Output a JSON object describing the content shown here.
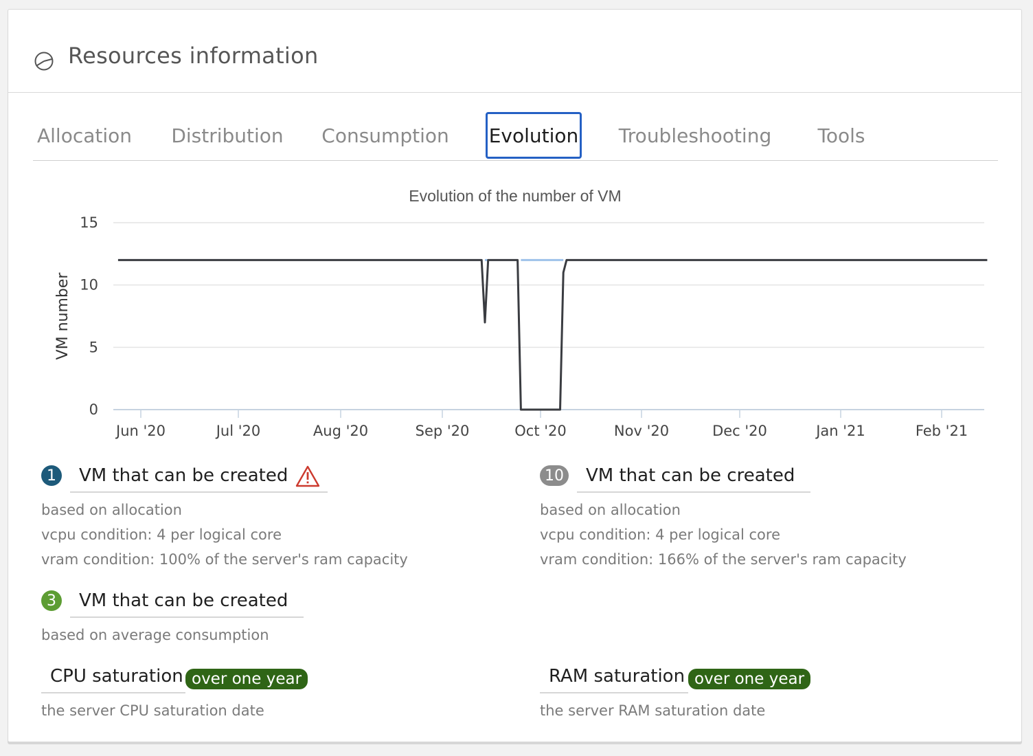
{
  "header": {
    "title": "Resources information",
    "icon": "pie-chart-icon"
  },
  "tabs": [
    {
      "label": "Allocation",
      "active": false
    },
    {
      "label": "Distribution",
      "active": false
    },
    {
      "label": "Consumption",
      "active": false
    },
    {
      "label": "Evolution",
      "active": true
    },
    {
      "label": "Troubleshooting",
      "active": false
    },
    {
      "label": "Tools",
      "active": false
    }
  ],
  "chart_data": {
    "type": "line",
    "title": "Evolution of the number of VM",
    "xlabel": "",
    "ylabel": "VM number",
    "ylim": [
      0,
      15
    ],
    "yticks": [
      "0",
      "5",
      "10",
      "15"
    ],
    "xticks": [
      "Jun '20",
      "Jul '20",
      "Aug '20",
      "Sep '20",
      "Oct '20",
      "Nov '20",
      "Dec '20",
      "Jan '21",
      "Feb '21"
    ],
    "grid": true,
    "legend": "none",
    "series": [
      {
        "color": "#3a3c41",
        "points": [
          [
            "2020-05-25",
            12
          ],
          [
            "2020-09-13",
            12
          ],
          [
            "2020-09-14",
            7
          ],
          [
            "2020-09-15",
            12
          ],
          [
            "2020-09-24",
            12
          ],
          [
            "2020-09-25",
            0
          ],
          [
            "2020-10-07",
            0
          ],
          [
            "2020-10-08",
            11
          ],
          [
            "2020-10-09",
            12
          ],
          [
            "2021-02-15",
            12
          ]
        ]
      },
      {
        "color": "#9ec2ea",
        "points": [
          [
            "2020-09-14",
            12
          ],
          [
            "2020-09-15",
            12
          ],
          [
            "2020-09-25",
            12
          ],
          [
            "2020-10-08",
            12
          ]
        ]
      }
    ]
  },
  "stats": {
    "alloc_1": {
      "count": "1",
      "badge_color": "#1d5a7a",
      "label": "VM that can be created",
      "warning_icon": "warning-triangle-icon",
      "lines": [
        "based on allocation",
        "vcpu condition: 4 per logical core",
        "vram condition: 100% of the server's ram capacity"
      ]
    },
    "alloc_2": {
      "count": "10",
      "badge_color": "#8c8c8c",
      "label": "VM that can be created",
      "lines": [
        "based on allocation",
        "vcpu condition: 4 per logical core",
        "vram condition: 166% of the server's ram capacity"
      ]
    },
    "consumption": {
      "count": "3",
      "badge_color": "#5d9d33",
      "label": "VM that can be created",
      "lines": [
        "based on average consumption"
      ]
    },
    "cpu_saturation": {
      "label": "CPU saturation",
      "pill": "over one year",
      "desc": "the server CPU saturation date"
    },
    "ram_saturation": {
      "label": "RAM saturation",
      "pill": "over one year",
      "desc": "the server RAM saturation date"
    }
  }
}
